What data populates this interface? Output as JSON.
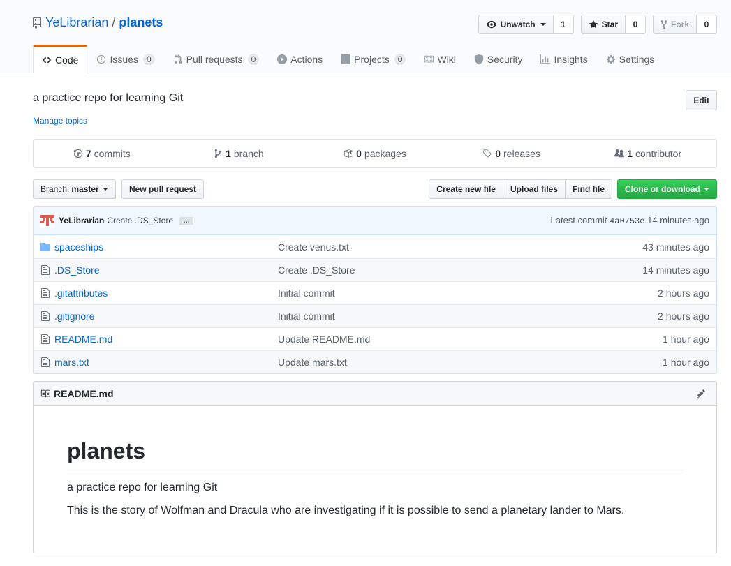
{
  "repo": {
    "owner": "YeLibrarian",
    "separator": "/",
    "name": "planets"
  },
  "actions": {
    "watch_label": "Unwatch",
    "watch_count": "1",
    "star_label": "Star",
    "star_count": "0",
    "fork_label": "Fork",
    "fork_count": "0"
  },
  "nav": {
    "code": "Code",
    "issues": "Issues",
    "issues_count": "0",
    "pulls": "Pull requests",
    "pulls_count": "0",
    "actions": "Actions",
    "projects": "Projects",
    "projects_count": "0",
    "wiki": "Wiki",
    "security": "Security",
    "insights": "Insights",
    "settings": "Settings"
  },
  "description": "a practice repo for learning Git",
  "manage_topics": "Manage topics",
  "edit_label": "Edit",
  "summary": {
    "commits_num": "7",
    "commits_label": "commits",
    "branch_num": "1",
    "branch_label": "branch",
    "packages_num": "0",
    "packages_label": "packages",
    "releases_num": "0",
    "releases_label": "releases",
    "contributor_num": "1",
    "contributor_label": "contributor"
  },
  "filenav": {
    "branch_prefix": "Branch:",
    "branch_name": "master",
    "new_pr": "New pull request",
    "create_file": "Create new file",
    "upload_files": "Upload files",
    "find_file": "Find file",
    "clone": "Clone or download"
  },
  "commit": {
    "author": "YeLibrarian",
    "message": "Create .DS_Store",
    "ellipsis": "…",
    "latest_label": "Latest commit",
    "sha": "4a0753e",
    "age": "14 minutes ago"
  },
  "files": [
    {
      "type": "folder",
      "name": "spaceships",
      "message": "Create venus.txt",
      "age": "43 minutes ago"
    },
    {
      "type": "file",
      "name": ".DS_Store",
      "message": "Create .DS_Store",
      "age": "14 minutes ago"
    },
    {
      "type": "file",
      "name": ".gitattributes",
      "message": "Initial commit",
      "age": "2 hours ago"
    },
    {
      "type": "file",
      "name": ".gitignore",
      "message": "Initial commit",
      "age": "2 hours ago"
    },
    {
      "type": "file",
      "name": "README.md",
      "message": "Update README.md",
      "age": "1 hour ago"
    },
    {
      "type": "file",
      "name": "mars.txt",
      "message": "Update mars.txt",
      "age": "1 hour ago"
    }
  ],
  "readme": {
    "filename": "README.md",
    "heading": "planets",
    "para1": "a practice repo for learning Git",
    "para2": "This is the story of Wolfman and Dracula who are investigating if it is possible to send a planetary lander to Mars."
  },
  "colors": {
    "link": "#0366d6",
    "accent_tab": "#e36209",
    "clone_green": "#28a745",
    "commit_bg": "#f1f8ff"
  }
}
